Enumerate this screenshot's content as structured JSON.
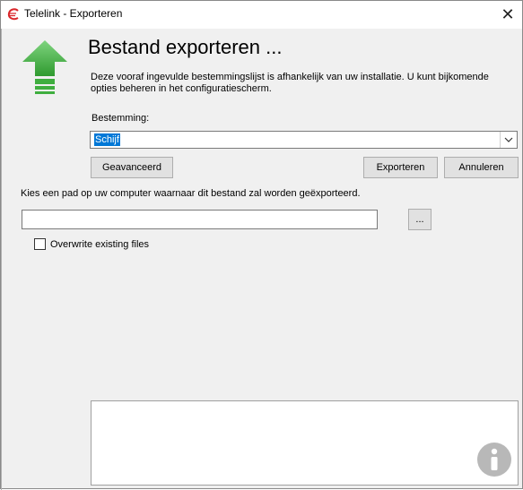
{
  "window": {
    "title": "Telelink - Exporteren",
    "close_glyph": "✕"
  },
  "header": {
    "heading": "Bestand exporteren ...",
    "description": "Deze vooraf ingevulde bestemmingslijst is afhankelijk van uw installatie. U kunt bijkomende opties beheren in het configuratiescherm.",
    "icon": "green-up-arrow-icon"
  },
  "destination": {
    "label": "Bestemming:",
    "value": "Schijf"
  },
  "buttons": {
    "advanced": "Geavanceerd",
    "export": "Exporteren",
    "cancel": "Annuleren",
    "browse": "..."
  },
  "path": {
    "label": "Kies een pad op uw computer waarnaar dit bestand zal worden geëxporteerd.",
    "value": ""
  },
  "overwrite": {
    "label": "Overwrite existing files",
    "checked": false
  },
  "colors": {
    "accent": "#0078d7",
    "arrow_green": "#3fae3f",
    "info_gray": "#b8b8b8"
  }
}
